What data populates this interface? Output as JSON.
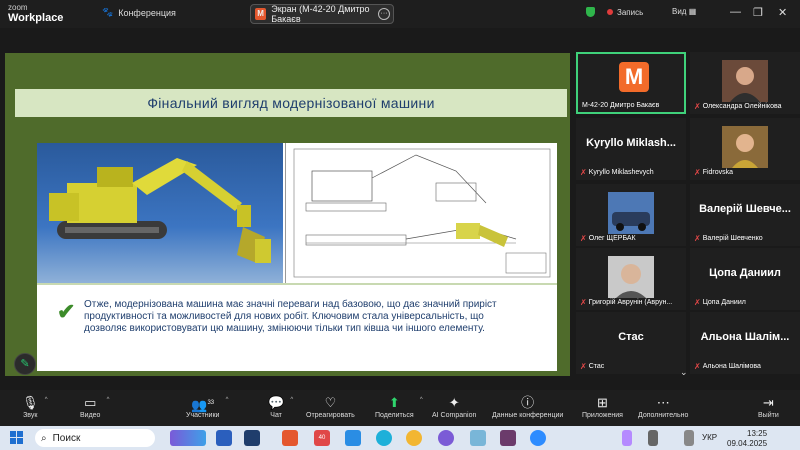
{
  "app": {
    "logo_line1": "zoom",
    "logo_line2": "Workplace",
    "meeting_label": "Конференция"
  },
  "share": {
    "badge": "M",
    "label": "Экран (М-42-20 Дмитро Бакаєв",
    "more": "···"
  },
  "topbar": {
    "record_label": "Запись",
    "view_label": "Вид",
    "minimize": "—",
    "restore": "❐",
    "close": "✕"
  },
  "slide": {
    "title": "Фінальний вигляд модернізованої машини",
    "text": "Отже, модернізована машина має значні переваги над базовою, що дає значний приріст продуктивності та можливостей для нових робіт. Ключовим стала універсальність, що дозволяє використовувати цю машину, змінюючи тільки тип ківша чи іншого елементу."
  },
  "participants": [
    {
      "caption": "М-42-20 Дмитро Бакаєв",
      "display": "",
      "avatar_letter": "M",
      "type": "letter",
      "active": true
    },
    {
      "caption": "Олександра Олейнікова",
      "display": "",
      "type": "photo",
      "active": false
    },
    {
      "caption": "Kyryllo Miklashevych",
      "display": "Kyryllo Miklash...",
      "type": "name",
      "active": false
    },
    {
      "caption": "Fidrovska",
      "display": "",
      "type": "photo",
      "active": false
    },
    {
      "caption": "Олег ЩЕРБАК",
      "display": "",
      "type": "photo",
      "active": false
    },
    {
      "caption": "Валерій Шевченко",
      "display": "Валерій Шевче...",
      "type": "name",
      "active": false
    },
    {
      "caption": "Григорій Аврунін (Аврун...",
      "display": "",
      "type": "photo",
      "active": false
    },
    {
      "caption": "Цопа Даниил",
      "display": "Цопа Даниил",
      "type": "name",
      "active": false
    },
    {
      "caption": "Стас",
      "display": "Стас",
      "type": "name",
      "active": false
    },
    {
      "caption": "Альона Шалімова",
      "display": "Альона Шалім...",
      "type": "name",
      "active": false
    }
  ],
  "toolbar": {
    "audio": "Звук",
    "video": "Видео",
    "participants": "Участники",
    "participants_count": "33",
    "chat": "Чат",
    "react": "Отреагировать",
    "share": "Поделиться",
    "ai": "AI Companion",
    "info": "Данные конференции",
    "apps": "Приложения",
    "more": "Дополнительно",
    "leave": "Выйти"
  },
  "taskbar": {
    "search": "Поиск",
    "lang": "УКР",
    "time": "13:25",
    "date": "09.04.2025",
    "mail_badge": "40"
  },
  "colors": {
    "slide_bg": "#4f6b2b",
    "title_band": "#d7e6c2",
    "title_text": "#1f3e6d",
    "active_border": "#3fd17a",
    "record": "#e03c3c",
    "leave": "#e74848"
  }
}
